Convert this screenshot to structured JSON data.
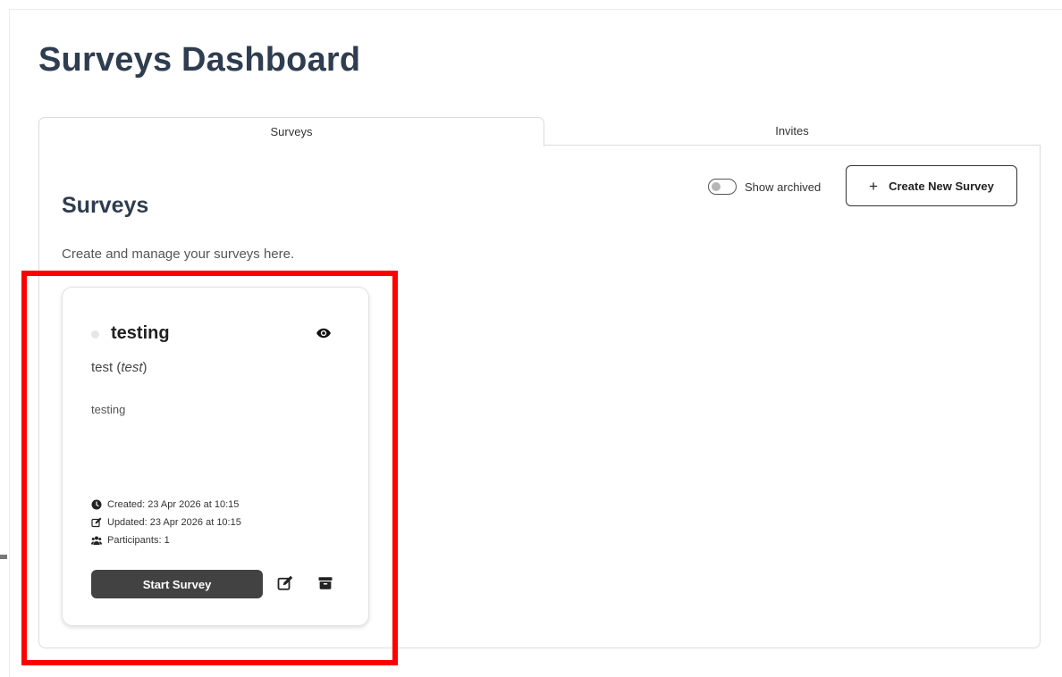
{
  "page": {
    "title": "Surveys Dashboard"
  },
  "tabs": [
    {
      "label": "Surveys",
      "active": true
    },
    {
      "label": "Invites",
      "active": false
    }
  ],
  "section": {
    "title": "Surveys",
    "description": "Create and manage your surveys here."
  },
  "controls": {
    "show_archived_label": "Show archived",
    "show_archived_on": false,
    "create_button_label": "Create New Survey",
    "create_button_icon": "plus-icon"
  },
  "survey_card": {
    "title": "testing",
    "subtitle_main": "test",
    "subtitle_paren": "test",
    "description": "testing",
    "created": "Created: 23 Apr 2026 at 10:15",
    "updated": "Updated: 23 Apr 2026 at 10:15",
    "participants": "Participants: 1",
    "start_button_label": "Start Survey",
    "icons": [
      "eye-icon",
      "clock-icon",
      "edit-note-icon",
      "users-icon",
      "edit-icon",
      "archive-icon"
    ]
  },
  "colors": {
    "title": "#2e3d4f",
    "start_button_bg": "#424242",
    "highlight_border": "#ff0000",
    "status_dot": "#e6e6e6"
  }
}
